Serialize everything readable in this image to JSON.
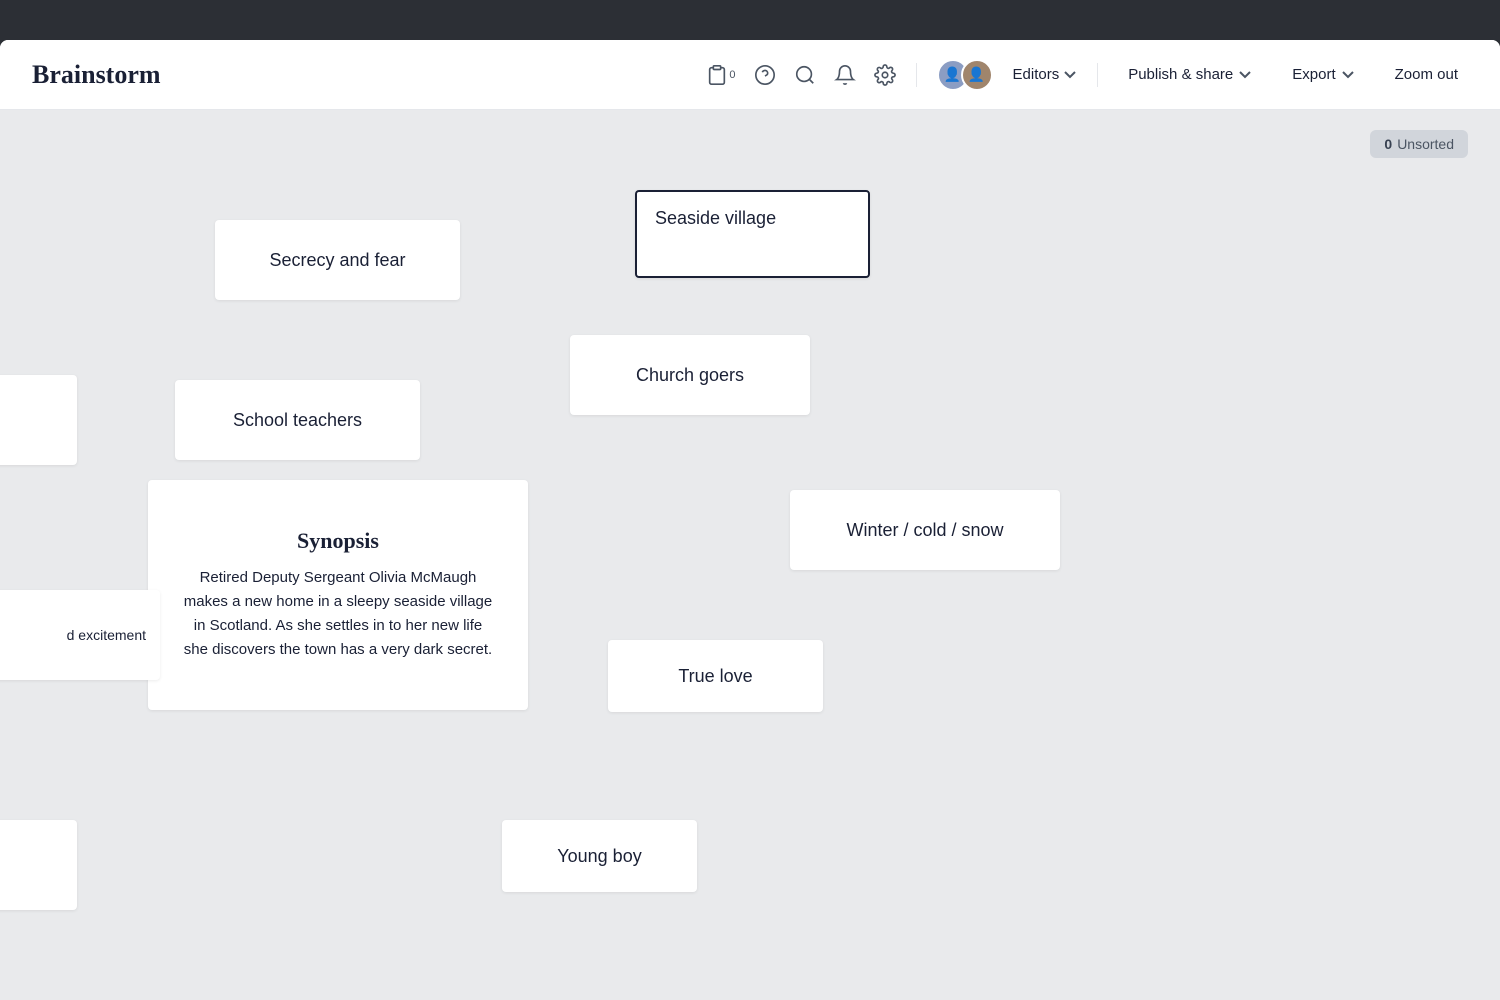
{
  "topbar": {},
  "header": {
    "title": "Brainstorm",
    "avatars": [
      {
        "label": "User 1",
        "color": "#8b9dc3"
      },
      {
        "label": "User 2",
        "color": "#a0856c"
      }
    ],
    "editors_label": "Editors",
    "publish_label": "Publish & share",
    "export_label": "Export",
    "zoom_label": "Zoom out"
  },
  "toolbar_icons": {
    "clipboard_badge": "0",
    "unsorted_label": "Unsorted",
    "unsorted_count": "0"
  },
  "cards": {
    "secrecy": "Secrecy and fear",
    "seaside": "Seaside village",
    "school": "School teachers",
    "church": "Church goers",
    "winter": "Winter / cold / snow",
    "truelove": "True love",
    "youngboy": "Young boy",
    "partial_text": "d excitement",
    "synopsis_title": "Synopsis",
    "synopsis_body": "Retired Deputy Sergeant Olivia McMaugh makes a new home in a sleepy seaside village in Scotland. As she settles in to her new life she discovers the town has a very dark secret."
  }
}
